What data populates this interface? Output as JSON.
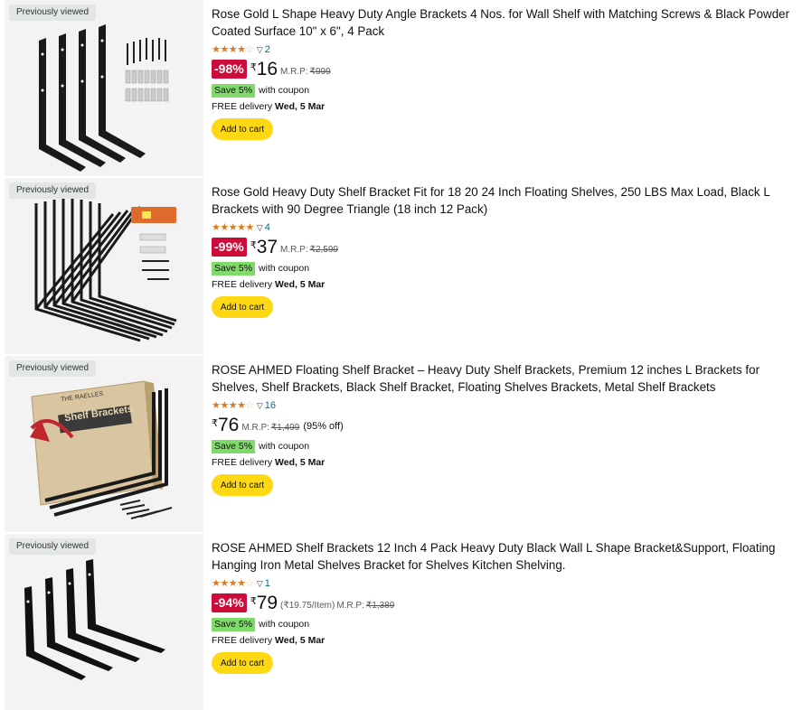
{
  "badge_label": "Previously viewed",
  "products": [
    {
      "title": "Rose Gold L Shape Heavy Duty Angle Brackets 4 Nos. for Wall Shelf with Matching Screws & Black Powder Coated Surface 10\" x 6\", 4 Pack",
      "stars": 3.5,
      "rating_count": "2",
      "discount": "-98%",
      "currency": "₹",
      "price": "16",
      "unit_price": "",
      "mrp_label": "M.R.P:",
      "mrp": "₹999",
      "percent_off": "",
      "coupon_badge": "Save 5%",
      "coupon_text": "with coupon",
      "delivery_prefix": "FREE delivery",
      "delivery_date": "Wed, 5 Mar",
      "cart_label": "Add to cart",
      "image_icon": "l-shape-brackets-with-screws"
    },
    {
      "title": "Rose Gold Heavy Duty Shelf Bracket Fit for 18 20 24 Inch Floating Shelves, 250 LBS Max Load, Black L Brackets with 90 Degree Triangle (18 inch 12 Pack)",
      "stars": 5,
      "rating_count": "4",
      "discount": "-99%",
      "currency": "₹",
      "price": "37",
      "unit_price": "",
      "mrp_label": "M.R.P:",
      "mrp": "₹2,599",
      "percent_off": "",
      "coupon_badge": "Save 5%",
      "coupon_text": "with coupon",
      "delivery_prefix": "FREE delivery",
      "delivery_date": "Wed, 5 Mar",
      "cart_label": "Add to cart",
      "image_icon": "triangle-brackets-12-pack"
    },
    {
      "title": "ROSE AHMED Floating Shelf Bracket – Heavy Duty Shelf Brackets, Premium 12 inches L Brackets for Shelves, Shelf Brackets, Black Shelf Bracket, Floating Shelves Brackets, Metal Shelf Brackets",
      "stars": 3.5,
      "rating_count": "16",
      "discount": "",
      "currency": "₹",
      "price": "76",
      "unit_price": "",
      "mrp_label": "M.R.P:",
      "mrp": "₹1,499",
      "percent_off": "(95% off)",
      "coupon_badge": "Save 5%",
      "coupon_text": "with coupon",
      "delivery_prefix": "FREE delivery",
      "delivery_date": "Wed, 5 Mar",
      "cart_label": "Add to cart",
      "image_icon": "boxed-shelf-brackets",
      "image_box_brand": "THE RAELLES",
      "image_box_title": "Shelf Brackets"
    },
    {
      "title": "ROSE AHMED Shelf Brackets 12 Inch 4 Pack Heavy Duty Black Wall L Shape Bracket&Support, Floating Hanging Iron Metal Shelves Bracket for Shelves Kitchen Shelving.",
      "stars": 3.5,
      "rating_count": "1",
      "discount": "-94%",
      "currency": "₹",
      "price": "79",
      "unit_price": "(₹19.75/Item)",
      "mrp_label": "M.R.P:",
      "mrp": "₹1,389",
      "percent_off": "",
      "coupon_badge": "Save 5%",
      "coupon_text": "with coupon",
      "delivery_prefix": "FREE delivery",
      "delivery_date": "Wed, 5 Mar",
      "cart_label": "Add to cart",
      "image_icon": "l-shape-brackets-4-pack"
    }
  ],
  "colors": {
    "star": "#de7921",
    "discount_badge": "#cc0c39",
    "coupon_badge": "#7fda69",
    "cart_button": "#ffd814",
    "link": "#007185"
  }
}
